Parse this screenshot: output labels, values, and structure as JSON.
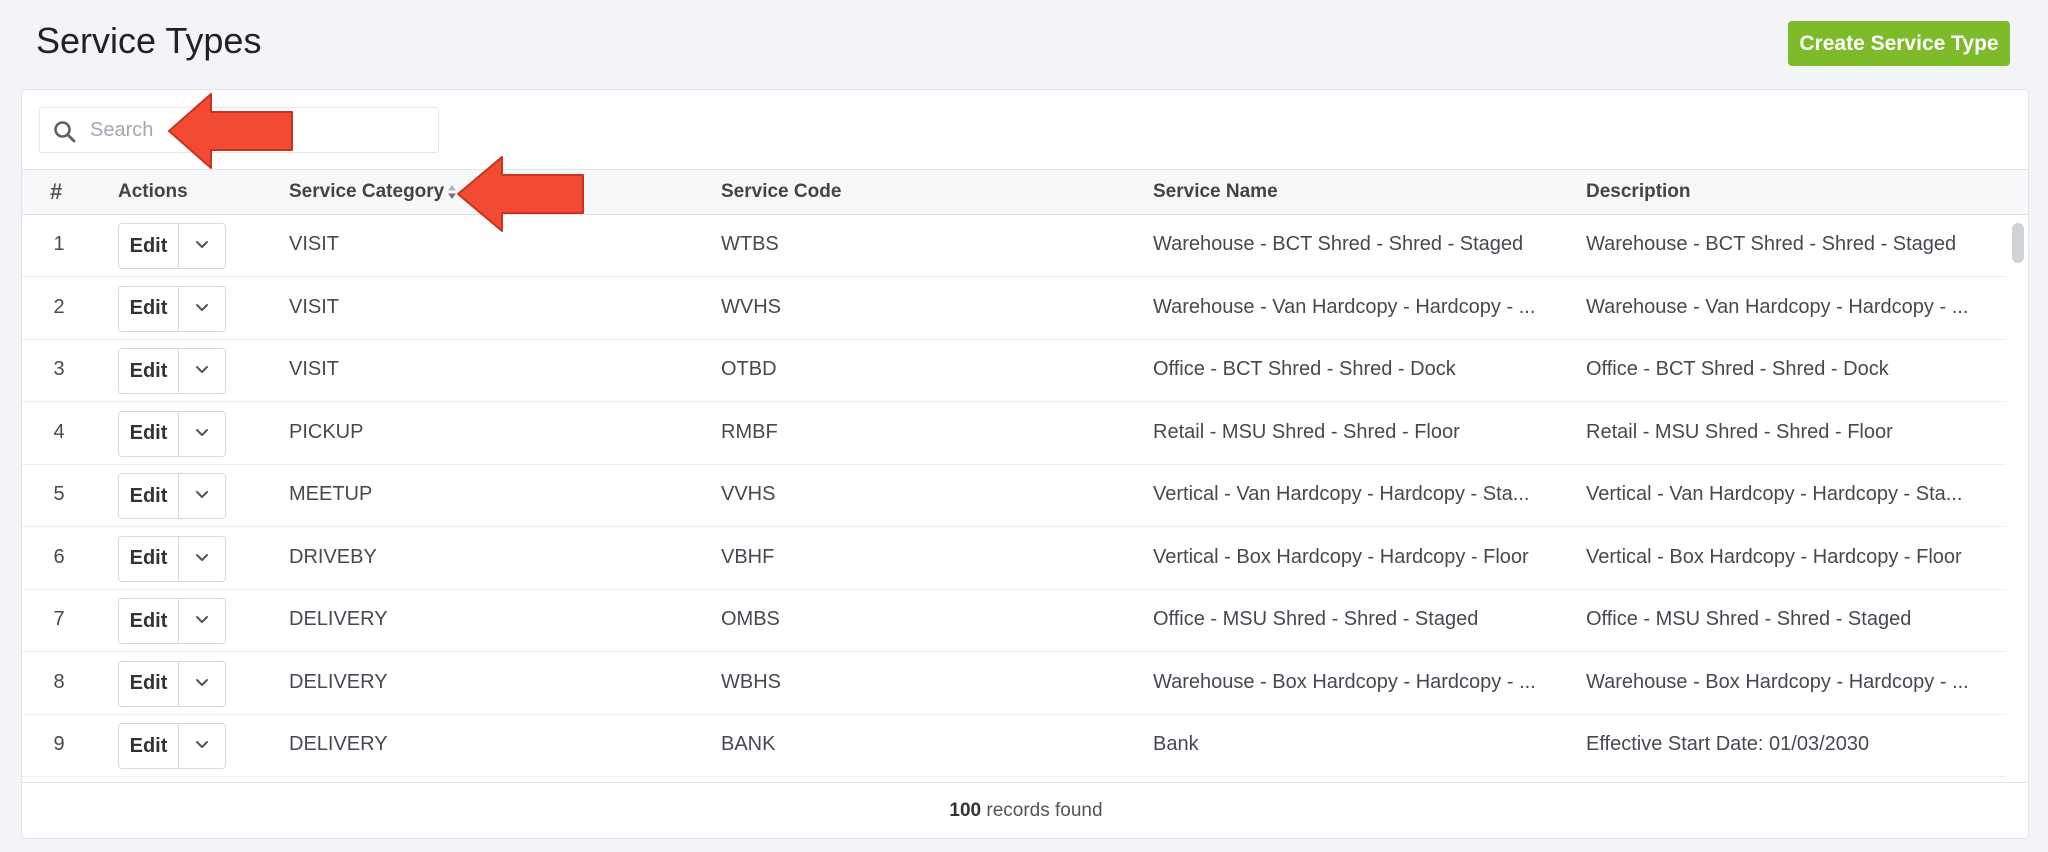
{
  "header": {
    "title": "Service Types",
    "create_button": "Create Service Type"
  },
  "search": {
    "placeholder": "Search",
    "value": ""
  },
  "table": {
    "columns": {
      "num": "#",
      "actions": "Actions",
      "category": "Service Category",
      "code": "Service Code",
      "name": "Service Name",
      "description": "Description"
    },
    "edit_label": "Edit",
    "rows": [
      {
        "num": "1",
        "category": "VISIT",
        "code": "WTBS",
        "name": "Warehouse - BCT Shred - Shred - Staged",
        "description": "Warehouse - BCT Shred - Shred - Staged"
      },
      {
        "num": "2",
        "category": "VISIT",
        "code": "WVHS",
        "name": "Warehouse - Van Hardcopy - Hardcopy - ...",
        "description": "Warehouse - Van Hardcopy - Hardcopy - ..."
      },
      {
        "num": "3",
        "category": "VISIT",
        "code": "OTBD",
        "name": "Office - BCT Shred - Shred - Dock",
        "description": "Office - BCT Shred - Shred - Dock"
      },
      {
        "num": "4",
        "category": "PICKUP",
        "code": "RMBF",
        "name": "Retail - MSU Shred - Shred - Floor",
        "description": "Retail - MSU Shred - Shred - Floor"
      },
      {
        "num": "5",
        "category": "MEETUP",
        "code": "VVHS",
        "name": "Vertical - Van Hardcopy - Hardcopy - Sta...",
        "description": "Vertical - Van Hardcopy - Hardcopy - Sta..."
      },
      {
        "num": "6",
        "category": "DRIVEBY",
        "code": "VBHF",
        "name": "Vertical - Box Hardcopy - Hardcopy - Floor",
        "description": "Vertical - Box Hardcopy - Hardcopy - Floor"
      },
      {
        "num": "7",
        "category": "DELIVERY",
        "code": "OMBS",
        "name": "Office - MSU Shred - Shred - Staged",
        "description": "Office - MSU Shred - Shred - Staged"
      },
      {
        "num": "8",
        "category": "DELIVERY",
        "code": "WBHS",
        "name": "Warehouse - Box Hardcopy - Hardcopy - ...",
        "description": "Warehouse - Box Hardcopy - Hardcopy - ..."
      },
      {
        "num": "9",
        "category": "DELIVERY",
        "code": "BANK",
        "name": "Bank",
        "description": "Effective Start Date: 01/03/2030"
      }
    ]
  },
  "footer": {
    "count": "100",
    "label": "records found"
  },
  "colors": {
    "accent": "#7dbb2b",
    "annotation_arrow": "#f24a33"
  },
  "icons": {
    "search": "search-icon",
    "sort": "sort-icon",
    "caret": "chevron-down-icon",
    "annotation": "arrow-left-icon"
  }
}
